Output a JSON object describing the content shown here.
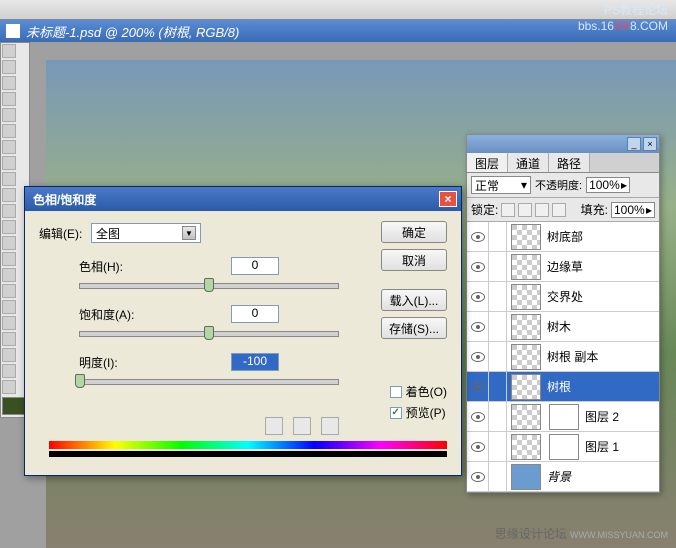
{
  "watermark": {
    "line1": "PS教程论坛",
    "line2_pre": "bbs.16",
    "line2_xx": "XX",
    "line2_post": "8.COM"
  },
  "titlebar": {
    "text": "未标题-1.psd @ 200% (树根, RGB/8)"
  },
  "hsat": {
    "title": "色相/饱和度",
    "edit_label": "编辑(E):",
    "edit_value": "全图",
    "hue_label": "色相(H):",
    "hue_value": "0",
    "sat_label": "饱和度(A):",
    "sat_value": "0",
    "light_label": "明度(I):",
    "light_value": "-100",
    "btn_ok": "确定",
    "btn_cancel": "取消",
    "btn_load": "载入(L)...",
    "btn_save": "存储(S)...",
    "chk_colorize": "着色(O)",
    "chk_preview": "预览(P)"
  },
  "layers": {
    "tabs": [
      "图层",
      "通道",
      "路径"
    ],
    "blend_mode": "正常",
    "opacity_label": "不透明度:",
    "opacity_value": "100%",
    "lock_label": "锁定:",
    "fill_label": "填充:",
    "fill_value": "100%",
    "items": [
      {
        "name": "树底部"
      },
      {
        "name": "边缘草"
      },
      {
        "name": "交界处"
      },
      {
        "name": "树木"
      },
      {
        "name": "树根 副本"
      },
      {
        "name": "树根",
        "selected": true
      },
      {
        "name": "图层 2",
        "mask": true
      },
      {
        "name": "图层 1",
        "mask": true
      },
      {
        "name": "背景",
        "bg": true,
        "italic": true
      }
    ]
  },
  "footer": {
    "text": "思缘设计论坛",
    "sub": "WWW.MISSYUAN.COM"
  }
}
